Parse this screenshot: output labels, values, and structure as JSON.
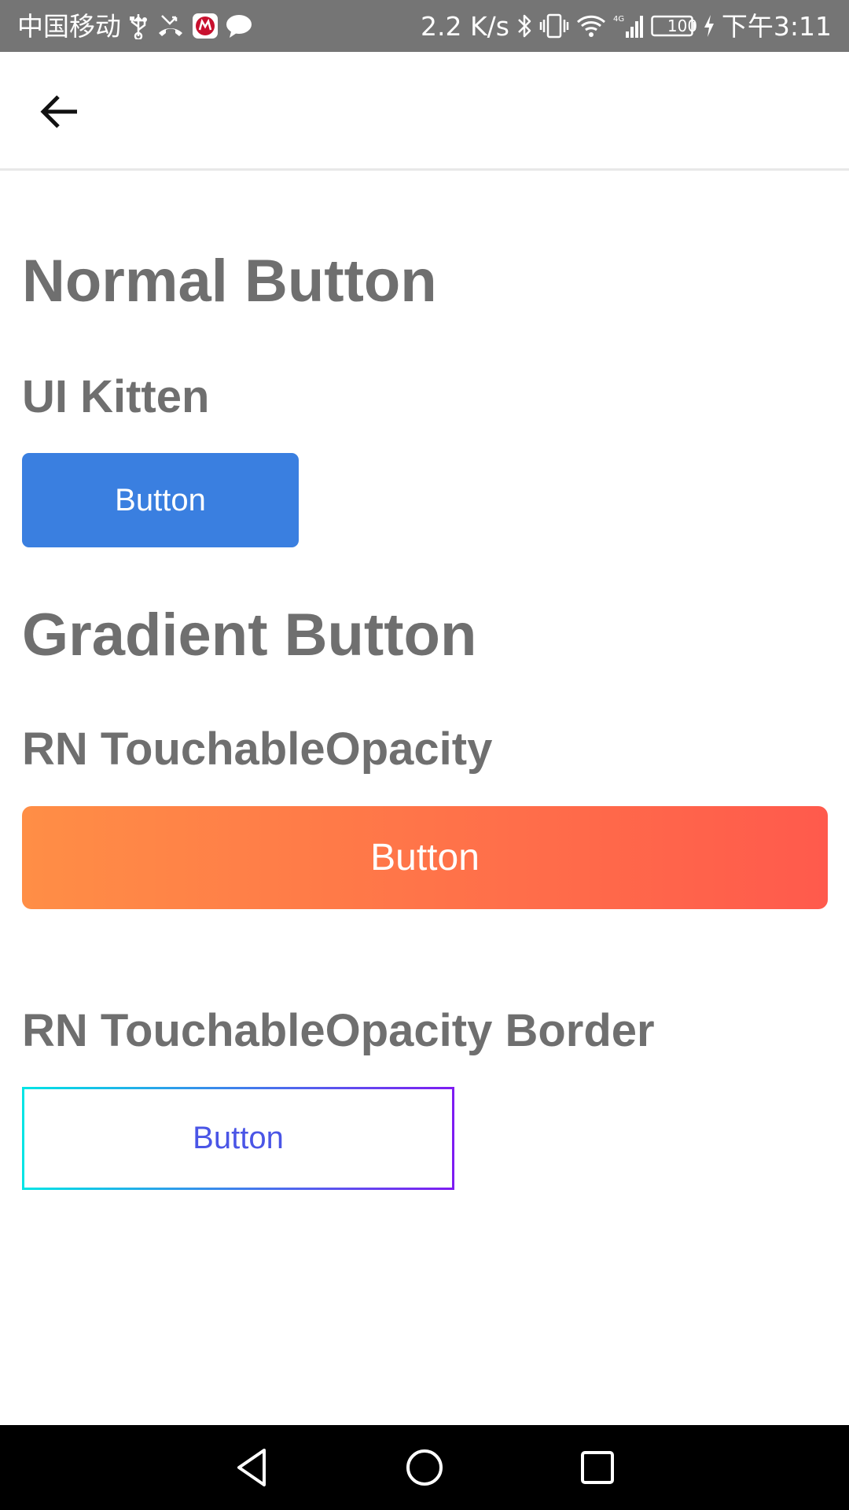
{
  "status_bar": {
    "carrier": "中国移动",
    "speed": "2.2 K/s",
    "battery": "100",
    "time": "下午3:11",
    "icons": [
      "usb-icon",
      "missed-call-icon",
      "app-notification-icon",
      "chat-bubble-icon",
      "bluetooth-icon",
      "vibrate-icon",
      "wifi-icon",
      "4g-signal-icon",
      "battery-icon",
      "charging-icon"
    ]
  },
  "app_bar": {
    "back_icon": "arrow-left-icon"
  },
  "sections": {
    "normal_title": "Normal Button",
    "ui_kitten_title": "UI Kitten",
    "ui_kitten_button": "Button",
    "gradient_title": "Gradient Button",
    "rn_touchable_title": "RN TouchableOpacity",
    "rn_touchable_button": "Button",
    "rn_border_title": "RN TouchableOpacity Border",
    "rn_border_button": "Button"
  },
  "colors": {
    "heading": "#6f6f6f",
    "kitten_primary": "#3a7fe0",
    "gradient_start": "#ff8e46",
    "gradient_end": "#ff5a4c",
    "border_gradient_start": "#00e5e5",
    "border_gradient_end": "#7e1bf2",
    "border_button_text": "#4a55e6"
  },
  "nav_bar": {
    "icons": [
      "back-triangle-icon",
      "home-circle-icon",
      "recents-square-icon"
    ]
  }
}
